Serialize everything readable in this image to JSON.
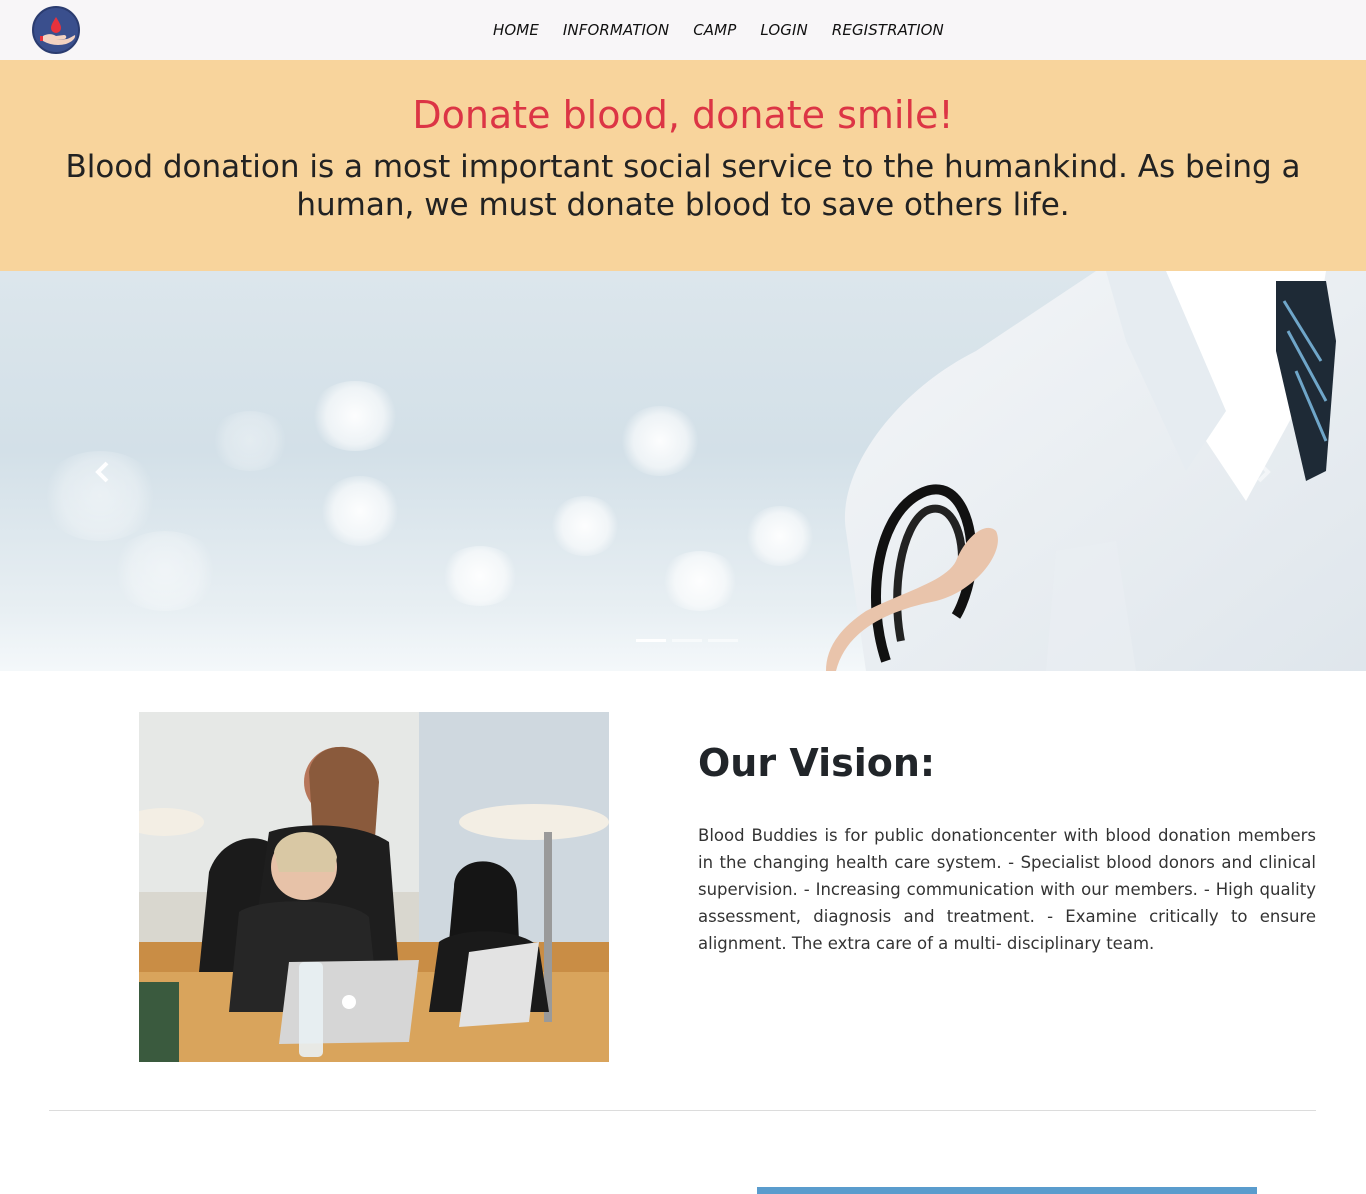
{
  "nav": {
    "logo_icon": "blood-drop-hand-icon",
    "links": [
      {
        "label": "HOME"
      },
      {
        "label": "INFORMATION"
      },
      {
        "label": "CAMP"
      },
      {
        "label": "LOGIN"
      },
      {
        "label": "REGISTRATION"
      }
    ]
  },
  "banner": {
    "title": "Donate blood, donate smile!",
    "text": "Blood donation is a most important social service to the humankind. As being a human, we must donate blood to save others life."
  },
  "carousel": {
    "prev_icon": "chevron-left-icon",
    "next_icon": "chevron-right-icon",
    "slide_count": 3,
    "active_slide": 1
  },
  "vision": {
    "heading": "Our Vision:",
    "text": "Blood Buddies is for public donationcenter with blood donation members in the changing health care system. - Specialist blood donors and clinical supervision. - Increasing communication with our members. - High quality assessment, diagnosis and treatment. - Examine critically to ensure alignment. The extra care of a multi- disciplinary team."
  },
  "colors": {
    "banner_bg": "#f8d49c",
    "title_red": "#dc3545",
    "navbar_bg": "#f8f6f8",
    "accent_blue": "#5a9ccd"
  }
}
